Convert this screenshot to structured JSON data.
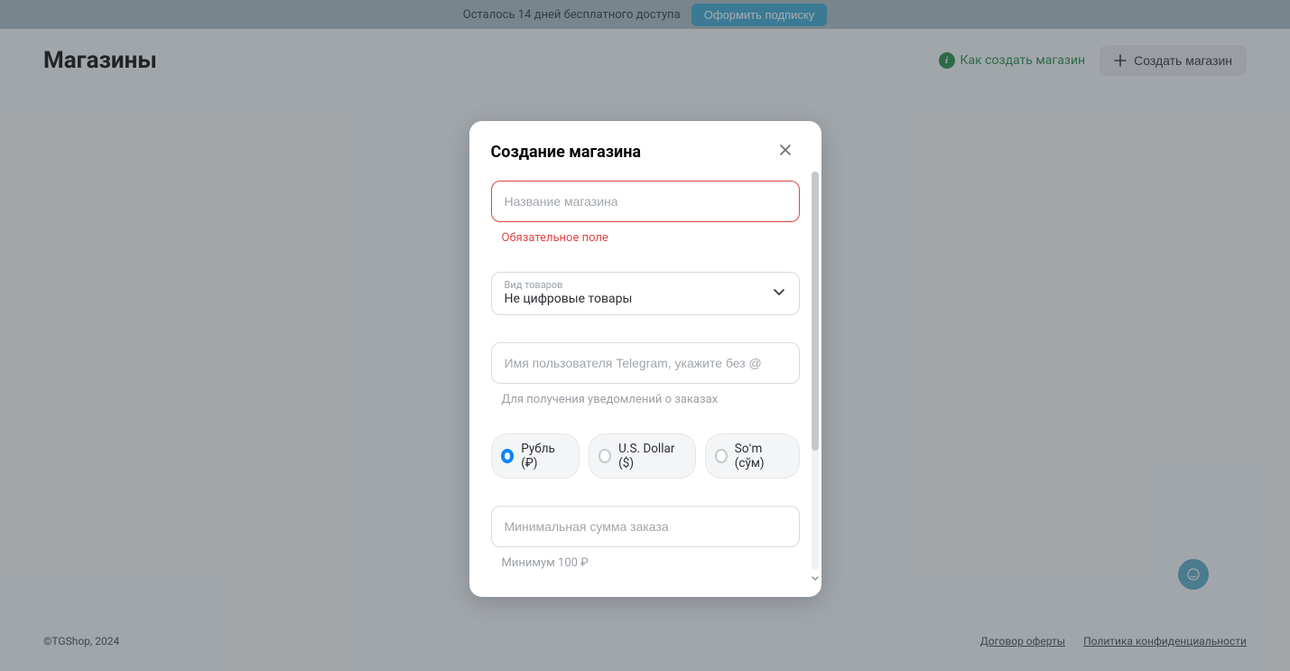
{
  "banner": {
    "trial_text": "Осталось 14 дней бесплатного доступа",
    "subscribe_btn": "Оформить подписку"
  },
  "header": {
    "title": "Магазины",
    "howto_link": "Как создать магазин",
    "create_shop_btn": "Создать магазин"
  },
  "modal": {
    "title": "Создание магазина",
    "name_placeholder": "Название магазина",
    "name_error": "Обязательное поле",
    "goods_type_label": "Вид товаров",
    "goods_type_value": "Не цифровые товары",
    "tg_username_placeholder": "Имя пользователя Telegram, укажите без @",
    "tg_username_helper": "Для получения уведомлений о заказах",
    "currencies": [
      {
        "label": "Рубль (₽)",
        "selected": true
      },
      {
        "label": "U.S. Dollar ($)",
        "selected": false
      },
      {
        "label": "Soʻm (сўм)",
        "selected": false
      }
    ],
    "min_order_placeholder": "Минимальная сумма заказа",
    "min_order_helper": "Минимум 100 ₽"
  },
  "footer": {
    "copyright": "©TGShop, 2024",
    "links": {
      "offer": "Договор оферты",
      "privacy": "Политика конфиденциальности"
    }
  }
}
